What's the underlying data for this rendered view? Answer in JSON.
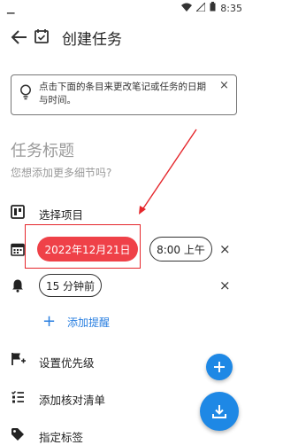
{
  "status_bar": {
    "time": "8:35"
  },
  "header": {
    "title": "创建任务"
  },
  "hint": {
    "text": "点击下面的条目来更改笔记或任务的日期与时间。",
    "close": "×"
  },
  "task": {
    "title_placeholder": "任务标题",
    "details_placeholder": "您想添加更多细节吗?"
  },
  "rows": {
    "project": "选择项目",
    "date": "2022年12月21日",
    "time": "8:00 上午",
    "reminder": "15 分钟前",
    "add_reminder": "添加提醒",
    "priority": "设置优先级",
    "checklist": "添加核对清单",
    "tags": "指定标签"
  },
  "remove_glyph": "×",
  "colors": {
    "accent": "#1e88e5",
    "date_chip": "#ef4148",
    "annotation": "#e5262b"
  }
}
